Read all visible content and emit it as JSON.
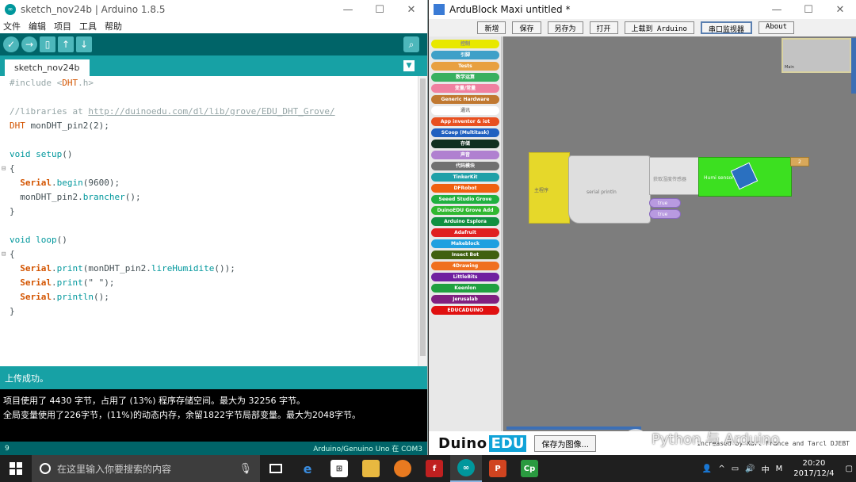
{
  "arduino": {
    "title": "sketch_nov24b | Arduino 1.8.5",
    "menu": [
      "文件",
      "编辑",
      "项目",
      "工具",
      "帮助"
    ],
    "tab": "sketch_nov24b",
    "code": [
      "#include <DHT.h>",
      "",
      "//libraries at http://duinoedu.com/dl/lib/grove/EDU_DHT_Grove/",
      "DHT monDHT_pin2(2);",
      "",
      "void setup()",
      "{",
      "  Serial.begin(9600);",
      "  monDHT_pin2.brancher();",
      "}",
      "",
      "void loop()",
      "{",
      "  Serial.print(monDHT_pin2.lireHumidite());",
      "  Serial.print(\" \");",
      "  Serial.println();",
      "}"
    ],
    "status": "上传成功。",
    "console": [
      "项目使用了 4430 字节，占用了 (13%) 程序存储空间。最大为 32256 字节。",
      "全局变量使用了226字节，(11%)的动态内存，余留1822字节局部变量。最大为2048字节。"
    ],
    "footer_line": "9",
    "footer_board": "Arduino/Genuino Uno 在 COM3"
  },
  "ardublock": {
    "title": "ArduBlock Maxi untitled *",
    "buttons": [
      "新增",
      "保存",
      "另存为",
      "打开",
      "上载到 Arduino",
      "串口监视器",
      "About"
    ],
    "palette": [
      {
        "label": "控制",
        "color": "#e8e800"
      },
      {
        "label": "引脚",
        "color": "#3fa0c8"
      },
      {
        "label": "Tests",
        "color": "#e8a040"
      },
      {
        "label": "数学运算",
        "color": "#38b060"
      },
      {
        "label": "变量/常量",
        "color": "#f080a0"
      },
      {
        "label": "Generic Hardware",
        "color": "#c07830"
      },
      {
        "label": "通讯",
        "color": "#ffffff"
      },
      {
        "label": "App inventor & iot",
        "color": "#e85020"
      },
      {
        "label": "SCoop (Multitask)",
        "color": "#2060c0"
      },
      {
        "label": "存储",
        "color": "#103020"
      },
      {
        "label": "声音",
        "color": "#b080d0"
      },
      {
        "label": "代码模块",
        "color": "#707070"
      },
      {
        "label": "TinkerKit",
        "color": "#20a0a8"
      },
      {
        "label": "DFRobot",
        "color": "#f06010"
      },
      {
        "label": "Seeed Studio Grove",
        "color": "#20b040"
      },
      {
        "label": "DuinoEDU Grove Add",
        "color": "#30b830"
      },
      {
        "label": "Arduino Esplora",
        "color": "#109040"
      },
      {
        "label": "Adafruit",
        "color": "#e02020"
      },
      {
        "label": "Makeblock",
        "color": "#20a0e0"
      },
      {
        "label": "Insect Bot",
        "color": "#406010"
      },
      {
        "label": "4Drawing",
        "color": "#f07020"
      },
      {
        "label": "LittleBits",
        "color": "#7020a0"
      },
      {
        "label": "Keenlon",
        "color": "#20a040"
      },
      {
        "label": "Jerusalab",
        "color": "#802080"
      },
      {
        "label": "EDUCADUINO",
        "color": "#e01010"
      }
    ],
    "blocks": {
      "loop_label": "主程序",
      "serial_label": "serial println",
      "humid_label": "获取湿度传感器",
      "temp_label": "Humi sensor",
      "pin_value": "2",
      "true1": "true",
      "true2": "true"
    },
    "save_image": "保存为图像...",
    "info": "Increased by Karl France and Tarcl DJEBT"
  },
  "taskbar": {
    "search_placeholder": "在这里输入你要搜索的内容",
    "tray_lang": "中",
    "tray_m": "M",
    "time": "20:20",
    "date": "2017/12/4"
  },
  "watermark": "Python 与 Arduino"
}
